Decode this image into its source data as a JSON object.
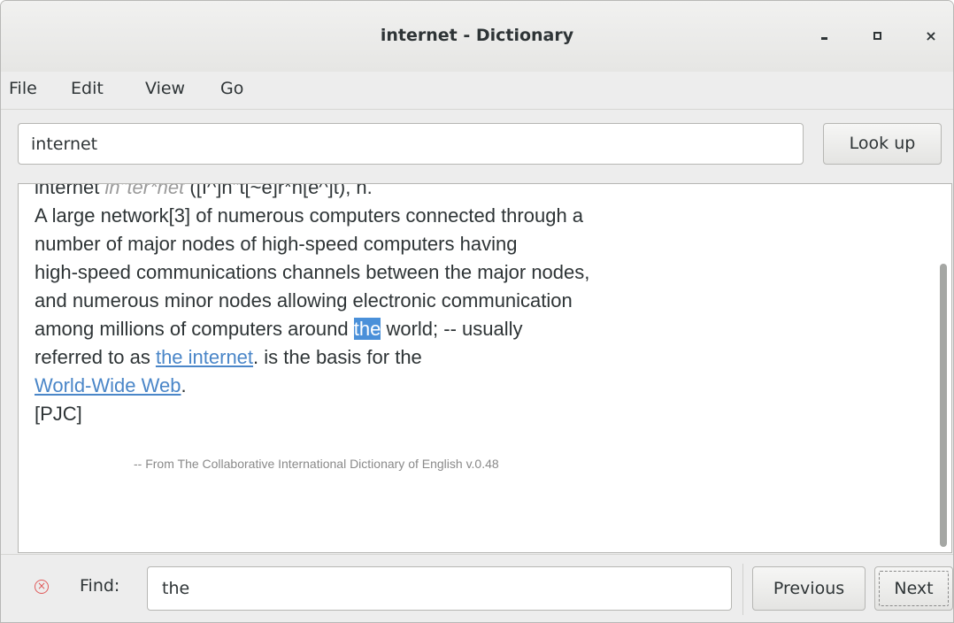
{
  "window": {
    "title": "internet - Dictionary",
    "controls": {
      "minimize": "-",
      "maximize": "□",
      "close": "×"
    }
  },
  "menu": {
    "file": "File",
    "edit": "Edit",
    "view": "View",
    "go": "Go"
  },
  "search": {
    "value": "internet",
    "button": "Look up"
  },
  "definition": {
    "headword": "internet",
    "pronunciation": "in\"ter*net",
    "phonetic": "([I^]n\"t[~e]r*n[e^]t), n.",
    "line1": "A large network[3] of numerous computers connected through a",
    "line2": "number of major nodes of high-speed computers having",
    "line3": "high-speed communications channels between the major nodes,",
    "line4": "and numerous minor nodes allowing electronic communication",
    "line5_before": "among millions of computers around ",
    "line5_highlight": "the",
    "line5_after": " world; -- usually",
    "line6_before": "referred to as ",
    "line6_link": "the internet",
    "line6_after": ". is the basis for the",
    "line7_link": "World-Wide Web",
    "line7_after": ".",
    "line8": "[PJC]",
    "source": "-- From The Collaborative International Dictionary of English v.0.48"
  },
  "find": {
    "close_icon": "close-circle-icon",
    "label": "Find:",
    "value": "the",
    "previous": "Previous",
    "next": "Next"
  },
  "colors": {
    "highlight": "#4a90d9",
    "link": "#4a86c8",
    "error": "#e05a5a"
  }
}
